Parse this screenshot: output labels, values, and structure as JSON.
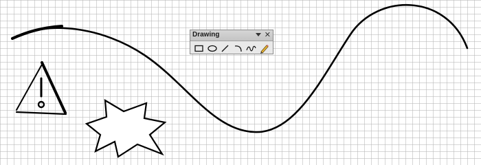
{
  "toolbar": {
    "title": "Drawing",
    "tools": [
      {
        "name": "rectangle",
        "icon": "rectangle-icon"
      },
      {
        "name": "ellipse",
        "icon": "ellipse-icon"
      },
      {
        "name": "line",
        "icon": "line-icon"
      },
      {
        "name": "arc",
        "icon": "arc-icon"
      },
      {
        "name": "freeform",
        "icon": "freeform-icon"
      },
      {
        "name": "pencil",
        "icon": "pencil-icon"
      }
    ]
  },
  "canvas": {
    "grid": true,
    "shapes": [
      {
        "kind": "curve",
        "icon": "curve-shape"
      },
      {
        "kind": "warning-triangle",
        "icon": "warning-triangle-shape"
      },
      {
        "kind": "starburst",
        "icon": "starburst-shape"
      }
    ]
  },
  "colors": {
    "stroke": "#000000",
    "grid": "#b4b4b4",
    "toolbar_bg": "#e9e9e9",
    "pencil": "#e8b93a"
  }
}
